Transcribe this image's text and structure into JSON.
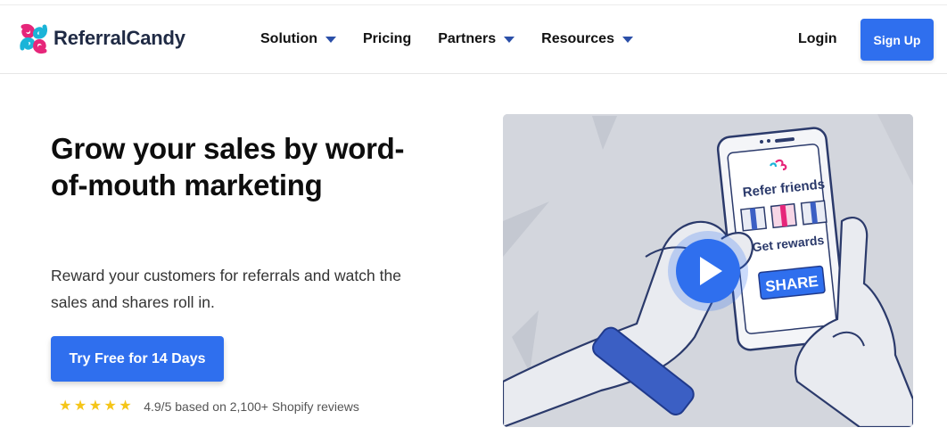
{
  "brand": {
    "name": "ReferralCandy",
    "logo_icon": "candy-swirl-logo-icon",
    "colors": {
      "pink": "#e6267a",
      "teal": "#1bb4d8",
      "navy": "#1f2a44"
    }
  },
  "nav": {
    "items": [
      {
        "label": "Solution",
        "dropdown": true
      },
      {
        "label": "Pricing",
        "dropdown": false
      },
      {
        "label": "Partners",
        "dropdown": true
      },
      {
        "label": "Resources",
        "dropdown": true
      }
    ],
    "login_label": "Login",
    "signup_label": "Sign Up"
  },
  "hero": {
    "title": "Grow your sales by word-of-mouth marketing",
    "subtitle": "Reward your customers for referrals and watch the sales and shares roll in.",
    "cta_label": "Try Free for 14 Days",
    "rating": {
      "stars": 5,
      "text": "4.9/5 based on 2,100+ Shopify reviews"
    }
  },
  "video": {
    "phone_heading": "Refer friends",
    "phone_subheading": "Get rewards",
    "phone_button": "SHARE",
    "play_icon": "play-icon"
  },
  "colors": {
    "accent": "#2f6fee",
    "star": "#f5c518",
    "video_bg": "#d3d6dd"
  }
}
